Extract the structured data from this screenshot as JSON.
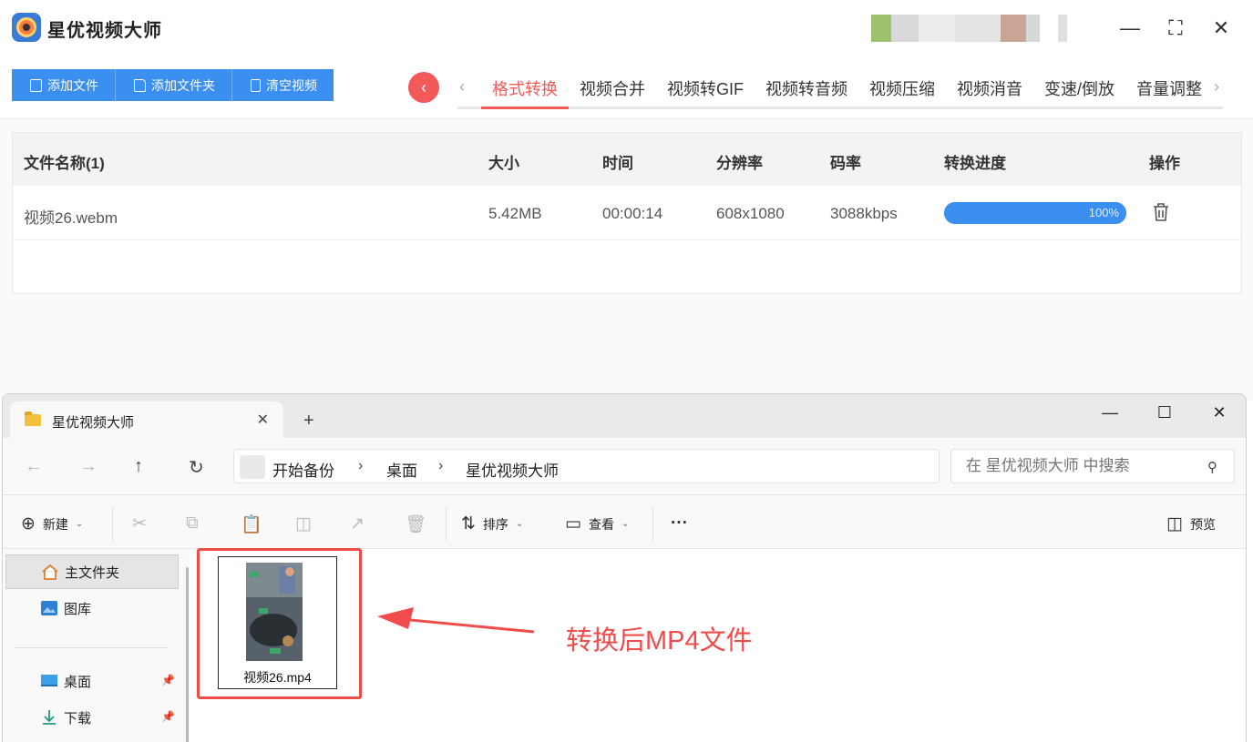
{
  "app": {
    "title": "星优视频大师",
    "toolbar": {
      "add_file": "添加文件",
      "add_folder": "添加文件夹",
      "clear": "清空视频"
    },
    "tabs": [
      "格式转换",
      "视频合并",
      "视频转GIF",
      "视频转音频",
      "视频压缩",
      "视频消音",
      "变速/倒放",
      "音量调整"
    ],
    "active_tab": "格式转换",
    "table": {
      "headers": {
        "name": "文件名称(1)",
        "size": "大小",
        "time": "时间",
        "resolution": "分辨率",
        "bitrate": "码率",
        "progress": "转换进度",
        "action": "操作"
      },
      "rows": [
        {
          "name": "视频26.webm",
          "size": "5.42MB",
          "time": "00:00:14",
          "resolution": "608x1080",
          "bitrate": "3088kbps",
          "progress_label": "100%",
          "progress": 1.0
        }
      ]
    },
    "colors": {
      "accent": "#3a8ff0",
      "active": "#f25a5a"
    }
  },
  "explorer": {
    "tab_title": "星优视频大师",
    "breadcrumb": [
      "开始备份",
      "桌面",
      "星优视频大师"
    ],
    "search_placeholder": "在 星优视频大师 中搜索",
    "commands": {
      "new": "新建",
      "sort": "排序",
      "view": "查看",
      "preview": "预览"
    },
    "sidebar": [
      {
        "label": "主文件夹",
        "icon": "home-icon"
      },
      {
        "label": "图库",
        "icon": "gallery-icon"
      },
      {
        "label": "桌面",
        "icon": "desktop-icon"
      },
      {
        "label": "下载",
        "icon": "download-icon"
      }
    ],
    "files": [
      {
        "name": "视频26.mp4"
      }
    ]
  },
  "annotation": {
    "text": "转换后MP4文件",
    "color": "#f04c4c"
  }
}
